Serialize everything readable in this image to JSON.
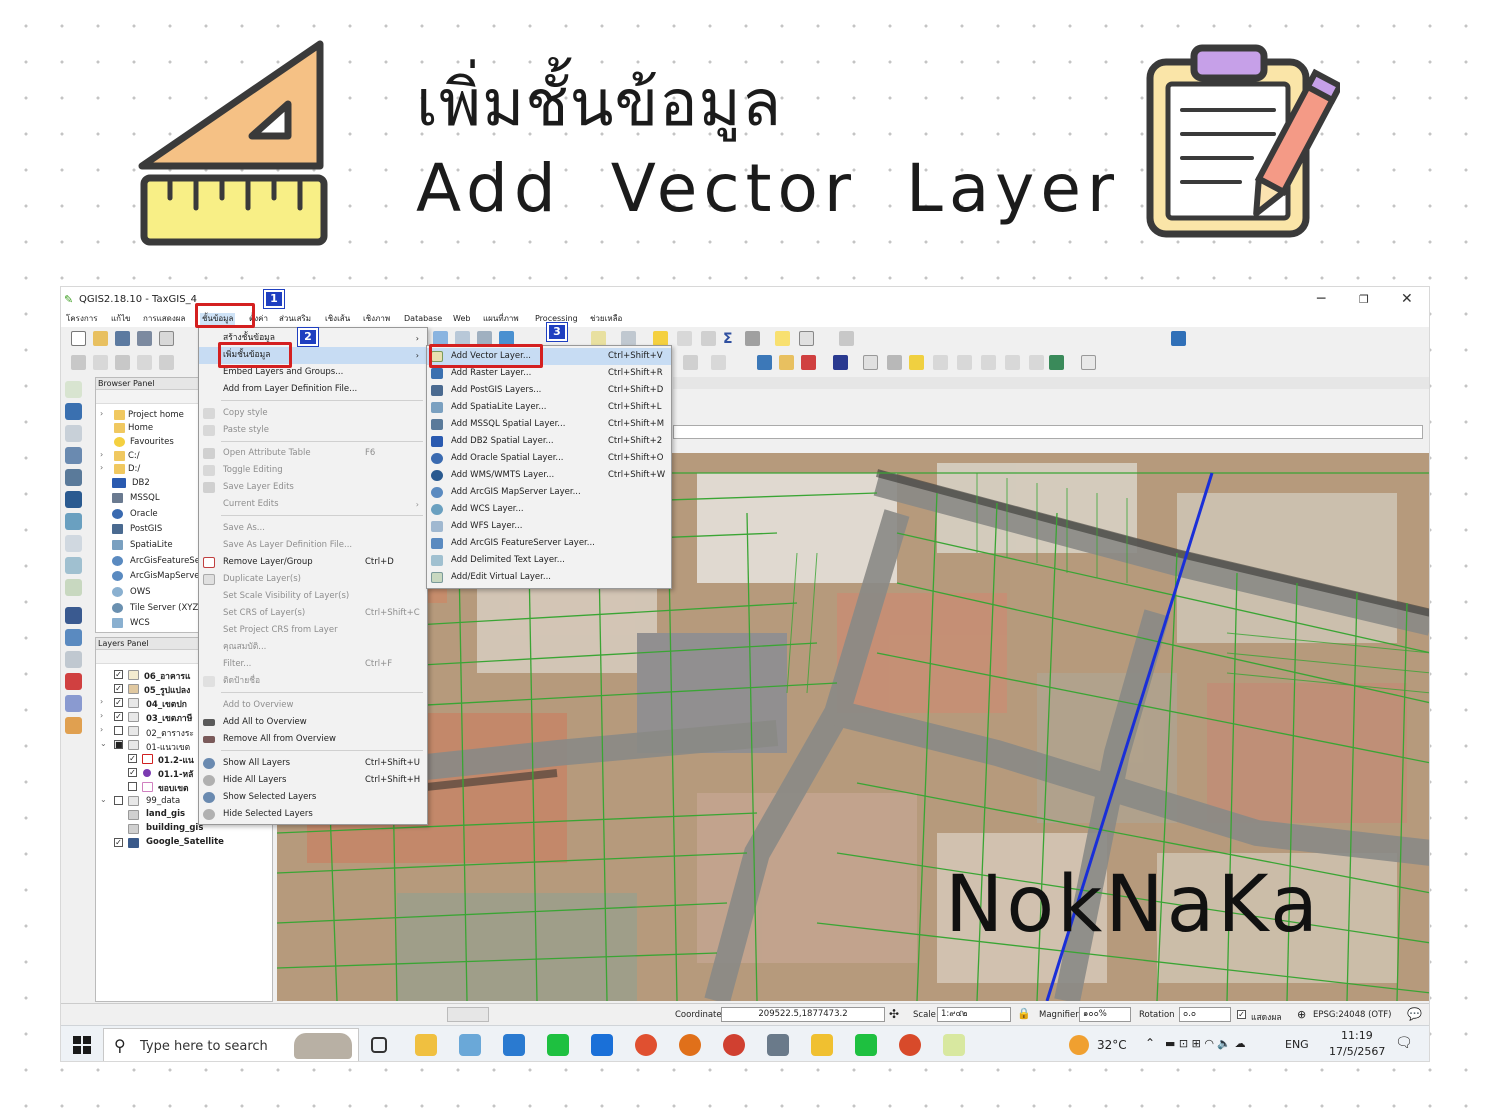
{
  "hero": {
    "title_th": "เพิ่มชั้นข้อมูล",
    "title_en": "Add Vector Layer",
    "watermark": "NokNaKa"
  },
  "window": {
    "title": "QGIS2.18.10 - TaxGIS_4",
    "minimize": "─",
    "maximize": "❐",
    "close": "✕"
  },
  "menubar": {
    "items": [
      "โครงการ",
      "แก้ไข",
      "การแสดงผล",
      "ชั้นข้อมูล",
      "ตั้งค่า",
      "ส่วนเสริม",
      "เชิงเส้น",
      "เชิงภาพ",
      "Database",
      "Web",
      "แผนที่ภาพ",
      "Processing",
      "ช่วยเหลือ"
    ]
  },
  "steps": {
    "one": "1",
    "two": "2",
    "three": "3"
  },
  "browser_panel": {
    "title": "Browser Panel",
    "items": [
      "Project home",
      "Home",
      "Favourites",
      "C:/",
      "D:/",
      "DB2",
      "MSSQL",
      "Oracle",
      "PostGIS",
      "SpatiaLite",
      "ArcGisFeatureSe",
      "ArcGisMapServe",
      "OWS",
      "Tile Server (XYZ",
      "WCS"
    ]
  },
  "layers_panel": {
    "title": "Layers Panel",
    "items": [
      "06_อาคารแ",
      "05_รูปแปลง",
      "04_เขตปก",
      "03_เขตภาษี",
      "02_ตารางระ",
      "01-แนวเขต",
      "01.2-แน",
      "01.1-หลั",
      "ขอบเขต",
      "99_data",
      "land_gis",
      "building_gis",
      "Google_Satellite"
    ]
  },
  "layer_menu": {
    "items": [
      {
        "label": "สร้างชั้นข้อมูล",
        "shortcut": "",
        "disabled": false
      },
      {
        "label": "เพิ่มชั้นข้อมูล",
        "shortcut": "",
        "disabled": false
      },
      {
        "label": "Embed Layers and Groups...",
        "shortcut": "",
        "disabled": false
      },
      {
        "label": "Add from Layer Definition File...",
        "shortcut": "",
        "disabled": false
      },
      {
        "label": "Copy style",
        "shortcut": "",
        "disabled": true
      },
      {
        "label": "Paste style",
        "shortcut": "",
        "disabled": true
      },
      {
        "label": "Open Attribute Table",
        "shortcut": "F6",
        "disabled": true
      },
      {
        "label": "Toggle Editing",
        "shortcut": "",
        "disabled": true
      },
      {
        "label": "Save Layer Edits",
        "shortcut": "",
        "disabled": true
      },
      {
        "label": "Current Edits",
        "shortcut": "",
        "disabled": true
      },
      {
        "label": "Save As...",
        "shortcut": "",
        "disabled": true
      },
      {
        "label": "Save As Layer Definition File...",
        "shortcut": "",
        "disabled": true
      },
      {
        "label": "Remove Layer/Group",
        "shortcut": "Ctrl+D",
        "disabled": false
      },
      {
        "label": "Duplicate Layer(s)",
        "shortcut": "",
        "disabled": true
      },
      {
        "label": "Set Scale Visibility of Layer(s)",
        "shortcut": "",
        "disabled": true
      },
      {
        "label": "Set CRS of Layer(s)",
        "shortcut": "Ctrl+Shift+C",
        "disabled": true
      },
      {
        "label": "Set Project CRS from Layer",
        "shortcut": "",
        "disabled": true
      },
      {
        "label": "คุณสมบัติ...",
        "shortcut": "",
        "disabled": true
      },
      {
        "label": "Filter...",
        "shortcut": "Ctrl+F",
        "disabled": true
      },
      {
        "label": "ติดป้ายชื่อ",
        "shortcut": "",
        "disabled": true
      },
      {
        "label": "Add to Overview",
        "shortcut": "",
        "disabled": true
      },
      {
        "label": "Add All to Overview",
        "shortcut": "",
        "disabled": false
      },
      {
        "label": "Remove All from Overview",
        "shortcut": "",
        "disabled": false
      },
      {
        "label": "Show All Layers",
        "shortcut": "Ctrl+Shift+U",
        "disabled": false
      },
      {
        "label": "Hide All Layers",
        "shortcut": "Ctrl+Shift+H",
        "disabled": false
      },
      {
        "label": "Show Selected Layers",
        "shortcut": "",
        "disabled": false
      },
      {
        "label": "Hide Selected Layers",
        "shortcut": "",
        "disabled": false
      }
    ]
  },
  "add_layer_menu": {
    "items": [
      {
        "label": "Add Vector Layer...",
        "shortcut": "Ctrl+Shift+V"
      },
      {
        "label": "Add Raster Layer...",
        "shortcut": "Ctrl+Shift+R"
      },
      {
        "label": "Add PostGIS Layers...",
        "shortcut": "Ctrl+Shift+D"
      },
      {
        "label": "Add SpatiaLite Layer...",
        "shortcut": "Ctrl+Shift+L"
      },
      {
        "label": "Add MSSQL Spatial Layer...",
        "shortcut": "Ctrl+Shift+M"
      },
      {
        "label": "Add DB2 Spatial Layer...",
        "shortcut": "Ctrl+Shift+2"
      },
      {
        "label": "Add Oracle Spatial Layer...",
        "shortcut": "Ctrl+Shift+O"
      },
      {
        "label": "Add WMS/WMTS Layer...",
        "shortcut": "Ctrl+Shift+W"
      },
      {
        "label": "Add ArcGIS MapServer Layer...",
        "shortcut": ""
      },
      {
        "label": "Add WCS Layer...",
        "shortcut": ""
      },
      {
        "label": "Add WFS Layer...",
        "shortcut": ""
      },
      {
        "label": "Add ArcGIS FeatureServer Layer...",
        "shortcut": ""
      },
      {
        "label": "Add Delimited Text Layer...",
        "shortcut": ""
      },
      {
        "label": "Add/Edit Virtual Layer...",
        "shortcut": ""
      }
    ]
  },
  "statusbar": {
    "coordinate_label": "Coordinate",
    "coordinate_value": "209522.5,1877473.2",
    "scale_label": "Scale",
    "scale_value": "1:๙๔๒",
    "magnifier_label": "Magnifier",
    "magnifier_value": "๑๐๐%",
    "rotation_label": "Rotation",
    "rotation_value": "๐.๐",
    "render_label": "แสดงผล",
    "crs": "EPSG:24048 (OTF)"
  },
  "taskbar": {
    "search_placeholder": "Type here to search",
    "temperature": "32°C",
    "language": "ENG",
    "time": "11:19",
    "date": "17/5/2567"
  },
  "colors": {
    "menu_highlight": "#c7dcf3",
    "redbox": "#d42020",
    "step_badge": "#1f3fc0",
    "parcel_lines": "#3aa534",
    "road_line": "#1a2fd8"
  }
}
